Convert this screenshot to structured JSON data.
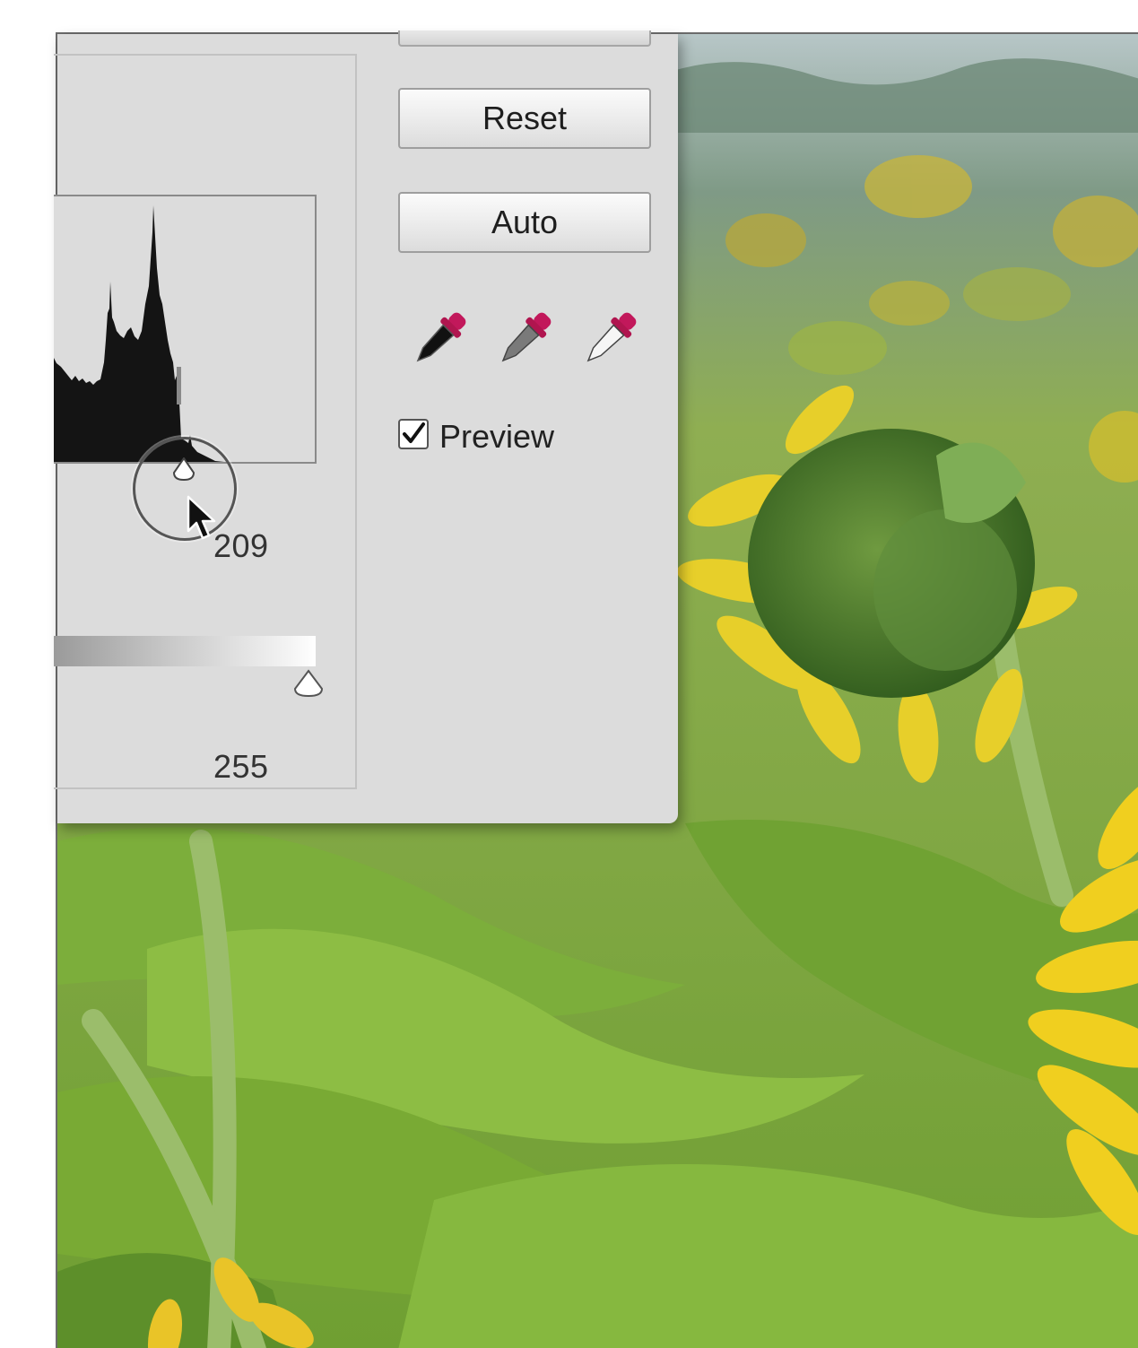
{
  "dialog": {
    "buttons": {
      "reset_label": "Reset",
      "auto_label": "Auto"
    },
    "eyedroppers": [
      "black-point-eyedropper",
      "gray-point-eyedropper",
      "white-point-eyedropper"
    ],
    "preview": {
      "label": "Preview",
      "checked": true
    },
    "input_levels": {
      "white_point": "209"
    },
    "output_levels": {
      "white_point": "255"
    }
  },
  "colors": {
    "dialog_bg": "#dcdcdc",
    "eyedropper_tip": "#c2185b",
    "histogram_fill": "#141414"
  },
  "background_photo": {
    "subject": "sunflower field"
  }
}
